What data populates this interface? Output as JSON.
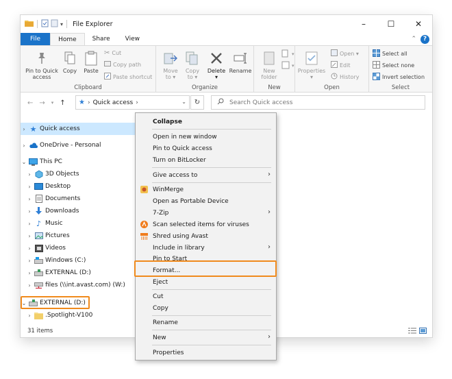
{
  "window": {
    "title": "File Explorer",
    "controls": {
      "minimize": "–",
      "maximize": "☐",
      "close": "✕"
    }
  },
  "tabs": [
    "File",
    "Home",
    "Share",
    "View"
  ],
  "ribbon": {
    "clipboard": {
      "label": "Clipboard",
      "pin": [
        "Pin to Quick",
        "access"
      ],
      "copy": "Copy",
      "paste": "Paste",
      "cut": "Cut",
      "copy_path": "Copy path",
      "paste_shortcut": "Paste shortcut"
    },
    "organize": {
      "label": "Organize",
      "move": [
        "Move",
        "to ▾"
      ],
      "copy": [
        "Copy",
        "to ▾"
      ],
      "delete": [
        "Delete",
        "▾"
      ],
      "rename": "Rename"
    },
    "new": {
      "label": "New",
      "new_folder": [
        "New",
        "folder"
      ]
    },
    "open": {
      "label": "Open",
      "properties": [
        "Properties",
        "▾"
      ],
      "open": "Open ▾",
      "edit": "Edit",
      "history": "History"
    },
    "select": {
      "label": "Select",
      "select_all": "Select all",
      "select_none": "Select none",
      "invert": "Invert selection"
    }
  },
  "address": {
    "path": "Quick access",
    "search_placeholder": "Search Quick access"
  },
  "nav": [
    {
      "label": "Quick access",
      "chev": "›"
    },
    {
      "label": "OneDrive - Personal",
      "chev": "›"
    },
    {
      "label": "This PC",
      "chev": "⌄"
    },
    {
      "label": "3D Objects",
      "chev": "›"
    },
    {
      "label": "Desktop",
      "chev": "›"
    },
    {
      "label": "Documents",
      "chev": "›"
    },
    {
      "label": "Downloads",
      "chev": "›"
    },
    {
      "label": "Music",
      "chev": "›"
    },
    {
      "label": "Pictures",
      "chev": "›"
    },
    {
      "label": "Videos",
      "chev": "›"
    },
    {
      "label": "Windows (C:)",
      "chev": "›"
    },
    {
      "label": "EXTERNAL (D:)",
      "chev": "›"
    },
    {
      "label": "files (\\\\int.avast.com) (W:)",
      "chev": "›"
    },
    {
      "label": "EXTERNAL (D:)",
      "chev": "⌄"
    },
    {
      "label": ".Spotlight-V100",
      "chev": "›"
    }
  ],
  "status": {
    "items": "31 items"
  },
  "context_menu": [
    "Collapse",
    "Open in new window",
    "Pin to Quick access",
    "Turn on BitLocker",
    "Give access to",
    "WinMerge",
    "Open as Portable Device",
    "7-Zip",
    "Scan selected items for viruses",
    "Shred using Avast",
    "Include in library",
    "Pin to Start",
    "Format...",
    "Eject",
    "Cut",
    "Copy",
    "Rename",
    "New",
    "Properties"
  ],
  "colors": {
    "accent": "#1a73c9",
    "highlight": "#f08a1c",
    "selection": "#cce8ff"
  }
}
